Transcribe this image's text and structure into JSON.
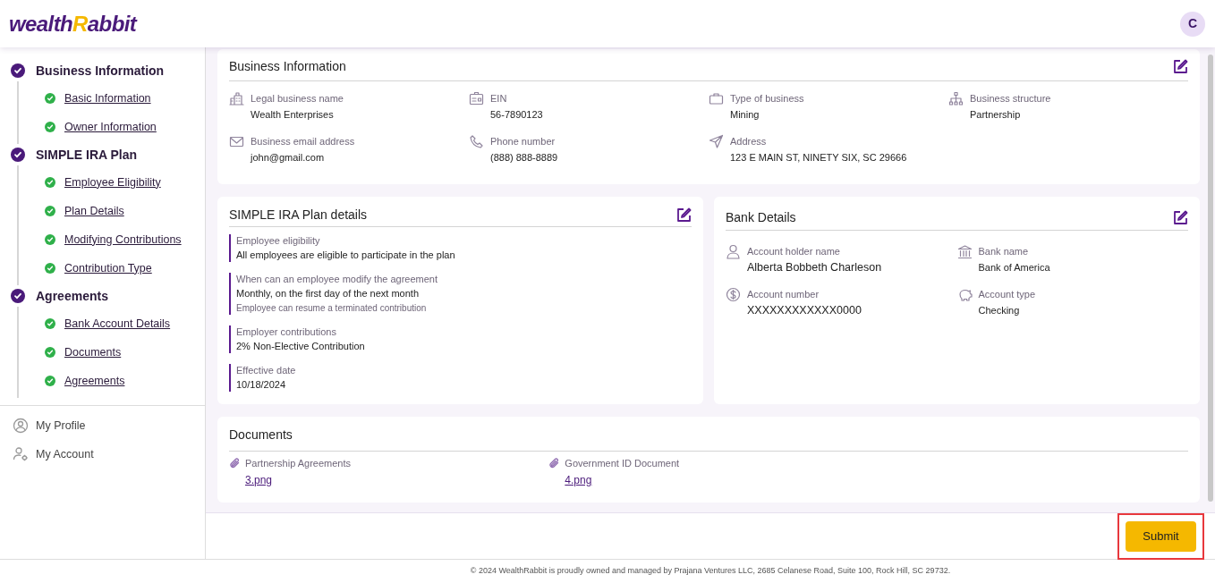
{
  "header": {
    "logo": [
      {
        "text": "wealth",
        "color": "#4a1a7a"
      },
      {
        "text": "R",
        "color": "#f5b800"
      },
      {
        "text": "abbit",
        "color": "#4a1a7a"
      }
    ],
    "avatar": "C"
  },
  "sidebar": {
    "groups": [
      {
        "title": "Business Information",
        "completed": true,
        "items": [
          {
            "label": "Basic Information",
            "completed": true
          },
          {
            "label": "Owner Information",
            "completed": true
          }
        ]
      },
      {
        "title": "SIMPLE IRA Plan",
        "completed": true,
        "items": [
          {
            "label": "Employee Eligibility",
            "completed": true
          },
          {
            "label": "Plan Details",
            "completed": true
          },
          {
            "label": "Modifying Contributions",
            "completed": true
          },
          {
            "label": "Contribution Type",
            "completed": true
          }
        ]
      },
      {
        "title": "Agreements",
        "completed": true,
        "items": [
          {
            "label": "Bank Account Details",
            "completed": true
          },
          {
            "label": "Documents",
            "completed": true
          },
          {
            "label": "Agreements",
            "completed": true
          }
        ]
      }
    ],
    "links": [
      {
        "kind": "profile",
        "label": "My Profile"
      },
      {
        "kind": "account",
        "label": "My Account"
      }
    ]
  },
  "business": {
    "title": "Business Information",
    "fields": [
      {
        "kind": "building",
        "label": "Legal business name",
        "value": "Wealth Enterprises"
      },
      {
        "kind": "id",
        "label": "EIN",
        "value": "56-7890123"
      },
      {
        "kind": "briefcase",
        "label": "Type of business",
        "value": "Mining"
      },
      {
        "kind": "structure",
        "label": "Business structure",
        "value": "Partnership"
      },
      {
        "kind": "mail",
        "label": "Business email address",
        "value": "john@gmail.com"
      },
      {
        "kind": "phone",
        "label": "Phone number",
        "value": "(888) 888-8889"
      },
      {
        "kind": "send",
        "label": "Address",
        "value": "123 E MAIN ST, NINETY SIX, SC 29666"
      }
    ]
  },
  "plan": {
    "title": "SIMPLE IRA Plan details",
    "items": [
      {
        "label": "Employee eligibility",
        "value": "All employees are eligible to participate in the plan"
      },
      {
        "label": "When can an employee modify the agreement",
        "value": "Monthly, on the first day of the next month",
        "note": "Employee can resume a terminated contribution"
      },
      {
        "label": "Employer contributions",
        "value": "2% Non-Elective Contribution"
      },
      {
        "label": "Effective date",
        "value": "10/18/2024"
      }
    ]
  },
  "bank": {
    "title": "Bank Details",
    "fields": [
      {
        "kind": "person",
        "label": "Account holder name",
        "value": "Alberta Bobbeth Charleson"
      },
      {
        "kind": "bank",
        "label": "Bank name",
        "value": "Bank of America"
      },
      {
        "kind": "dollar",
        "label": "Account number",
        "value": "XXXXXXXXXXXX0000"
      },
      {
        "kind": "piggy",
        "label": "Account type",
        "value": "Checking"
      }
    ]
  },
  "documents": {
    "title": "Documents",
    "files": [
      {
        "label": "Partnership Agreements",
        "file": "3.png"
      },
      {
        "label": "Government ID Document",
        "file": "4.png"
      }
    ]
  },
  "submit": {
    "label": "Submit",
    "highlighted": true
  },
  "footer": "© 2024 WealthRabbit is proudly owned and managed by Prajana Ventures LLC, 2685 Celanese Road, Suite 100, Rock Hill, SC 29732."
}
